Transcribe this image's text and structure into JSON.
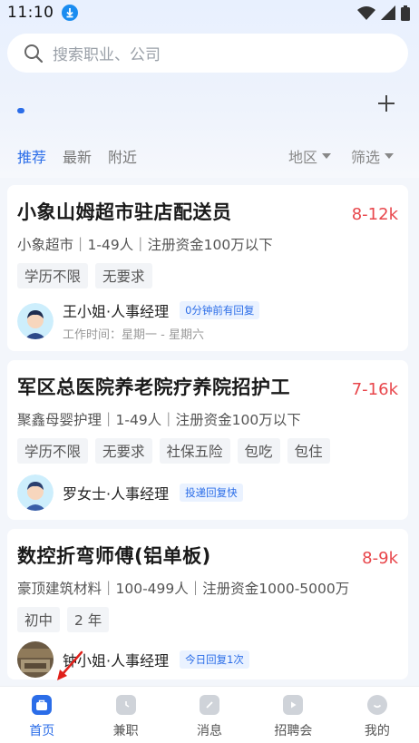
{
  "status_bar": {
    "time": "11:10"
  },
  "search": {
    "placeholder": "搜索职业、公司"
  },
  "tabs": [
    {
      "label": "推荐",
      "active": true
    },
    {
      "label": "最新",
      "active": false
    },
    {
      "label": "附近",
      "active": false
    }
  ],
  "filters": [
    {
      "label": "地区"
    },
    {
      "label": "筛选"
    }
  ],
  "jobs": [
    {
      "title": "小象山姆超市驻店配送员",
      "salary": "8-12k",
      "company": "小象超市｜1-49人｜注册资金100万以下",
      "tags": [
        "学历不限",
        "无要求"
      ],
      "recruiter": "王小姐·人事经理",
      "badge": "0分钟前有回复",
      "worktime": "工作时间：星期一 - 星期六"
    },
    {
      "title": "军区总医院养老院疗养院招护工",
      "salary": "7-16k",
      "company": "聚鑫母婴护理｜1-49人｜注册资金100万以下",
      "tags": [
        "学历不限",
        "无要求",
        "社保五险",
        "包吃",
        "包住"
      ],
      "recruiter": "罗女士·人事经理",
      "badge": "投递回复快"
    },
    {
      "title": "数控折弯师傅(铝单板)",
      "salary": "8-9k",
      "company": "豪顶建筑材料｜100-499人｜注册资金1000-5000万",
      "tags": [
        "初中",
        "2 年"
      ],
      "recruiter": "钟小姐·人事经理",
      "badge": "今日回复1次"
    }
  ],
  "bottom_nav": [
    {
      "label": "首页",
      "icon": "bag-icon",
      "active": true
    },
    {
      "label": "兼职",
      "icon": "clock-icon",
      "active": false
    },
    {
      "label": "消息",
      "icon": "chat-icon",
      "active": false
    },
    {
      "label": "招聘会",
      "icon": "play-icon",
      "active": false
    },
    {
      "label": "我的",
      "icon": "smile-icon",
      "active": false
    }
  ],
  "colors": {
    "accent": "#2b6de8",
    "salary": "#e8464b",
    "annotation_arrow": "#e0201a"
  }
}
